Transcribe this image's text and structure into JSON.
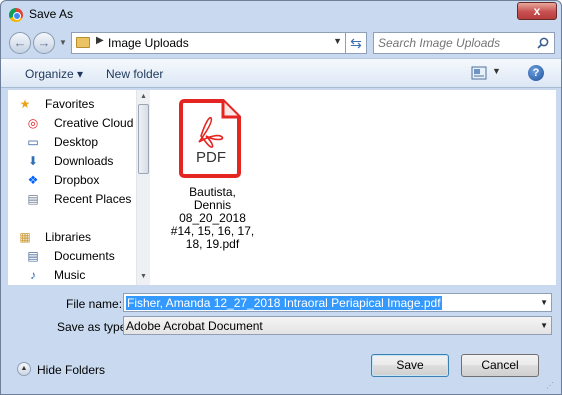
{
  "window": {
    "title": "Save As",
    "close_label": "x"
  },
  "nav": {
    "back_glyph": "←",
    "forward_glyph": "→",
    "breadcrumb_sep": "▶",
    "path": "Image Uploads",
    "refresh_icon": "refresh-icon",
    "search_placeholder": "Search Image Uploads"
  },
  "toolbar": {
    "organize_label": "Organize ▾",
    "new_folder_label": "New folder",
    "help_label": "?"
  },
  "sidebar": {
    "items": [
      {
        "label": "Favorites",
        "icon": "star-icon",
        "glyph": "★",
        "level": "top"
      },
      {
        "label": "Creative Cloud Fi",
        "icon": "creative-cloud-icon",
        "glyph": "◎",
        "level": "child"
      },
      {
        "label": "Desktop",
        "icon": "desktop-icon",
        "glyph": "▭",
        "level": "child"
      },
      {
        "label": "Downloads",
        "icon": "downloads-icon",
        "glyph": "⬇",
        "level": "child"
      },
      {
        "label": "Dropbox",
        "icon": "dropbox-icon",
        "glyph": "❖",
        "level": "child"
      },
      {
        "label": "Recent Places",
        "icon": "recent-places-icon",
        "glyph": "▤",
        "level": "child"
      },
      {
        "label": "Libraries",
        "icon": "libraries-icon",
        "glyph": "▦",
        "level": "top"
      },
      {
        "label": "Documents",
        "icon": "documents-icon",
        "glyph": "▤",
        "level": "child"
      },
      {
        "label": "Music",
        "icon": "music-icon",
        "glyph": "♪",
        "level": "child"
      }
    ]
  },
  "files": [
    {
      "name": "Bautista, Dennis 08_20_2018 #14, 15, 16, 17, 18, 19.pdf",
      "badge": "PDF"
    }
  ],
  "form": {
    "file_name_label": "File name:",
    "file_name_value": "Fisher, Amanda 12_27_2018 Intraoral Periapical Image.pdf",
    "save_type_label": "Save as type:",
    "save_type_value": "Adobe Acrobat Document"
  },
  "footer": {
    "hide_folders_label": "Hide Folders",
    "save_label": "Save",
    "cancel_label": "Cancel"
  },
  "colors": {
    "accent": "#3399ff",
    "pdf_red": "#e52521",
    "chrome": "#c9daf0"
  }
}
